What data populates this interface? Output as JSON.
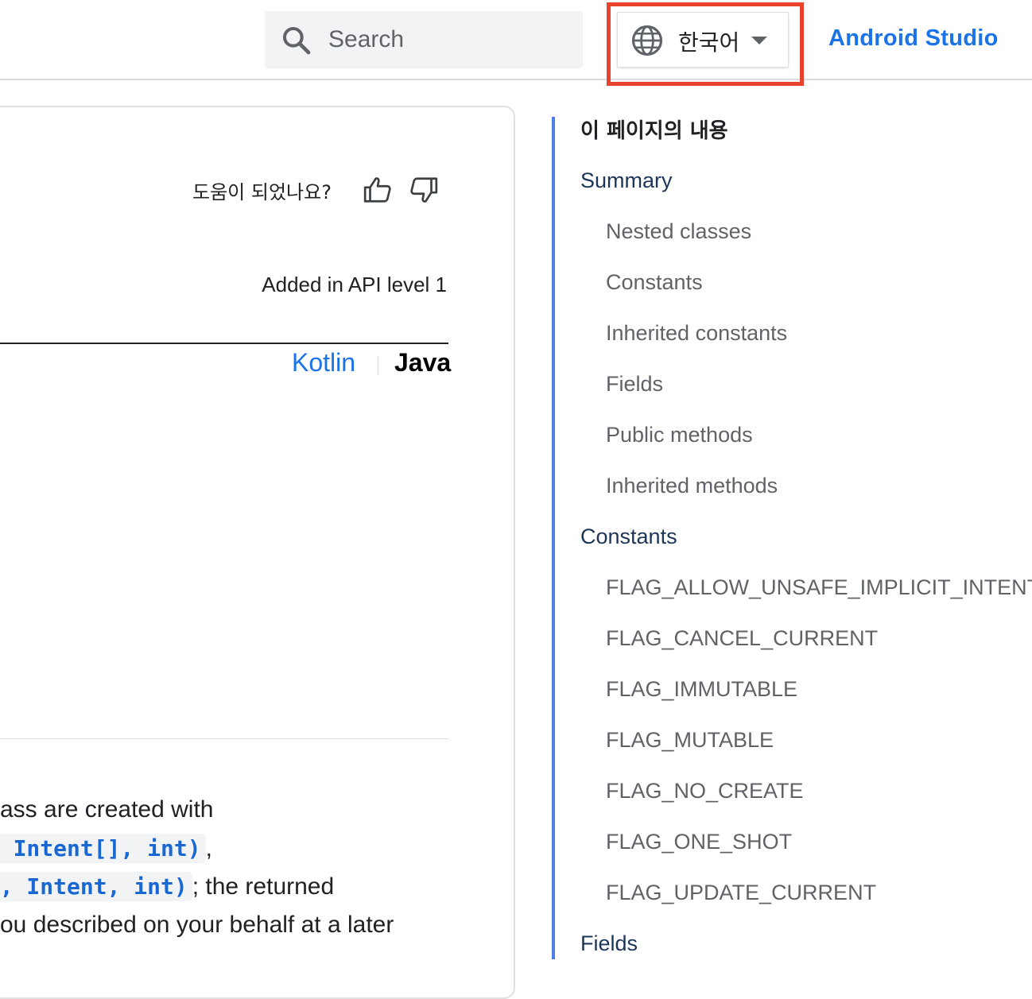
{
  "header": {
    "search_placeholder": "Search",
    "language_label": "한국어",
    "android_studio_link": "Android Studio"
  },
  "content": {
    "helpful_question": "도움이 되었나요?",
    "api_level": "Added in API level 1",
    "lang_tabs": {
      "kotlin": "Kotlin",
      "java": "Java"
    },
    "description_lines": {
      "line1_text": "ass are created with",
      "line2_code": "t, Intent[], int)",
      "line2_after": ",",
      "line3_code": "nt, Intent, int)",
      "line3_after": "; the returned",
      "line4_text": "ou described on your behalf at a later"
    }
  },
  "toc": {
    "title": "이 페이지의 내용",
    "items": [
      {
        "label": "Summary",
        "level": 1
      },
      {
        "label": "Nested classes",
        "level": 2
      },
      {
        "label": "Constants",
        "level": 2
      },
      {
        "label": "Inherited constants",
        "level": 2
      },
      {
        "label": "Fields",
        "level": 2
      },
      {
        "label": "Public methods",
        "level": 2
      },
      {
        "label": "Inherited methods",
        "level": 2
      },
      {
        "label": "Constants",
        "level": 1
      },
      {
        "label": "FLAG_ALLOW_UNSAFE_IMPLICIT_INTENT",
        "level": 2
      },
      {
        "label": "FLAG_CANCEL_CURRENT",
        "level": 2
      },
      {
        "label": "FLAG_IMMUTABLE",
        "level": 2
      },
      {
        "label": "FLAG_MUTABLE",
        "level": 2
      },
      {
        "label": "FLAG_NO_CREATE",
        "level": 2
      },
      {
        "label": "FLAG_ONE_SHOT",
        "level": 2
      },
      {
        "label": "FLAG_UPDATE_CURRENT",
        "level": 2
      },
      {
        "label": "Fields",
        "level": 1
      }
    ]
  },
  "colors": {
    "link_blue": "#1a73e8",
    "highlight_red": "#e8412c",
    "toc_rail": "#4a80e8"
  }
}
